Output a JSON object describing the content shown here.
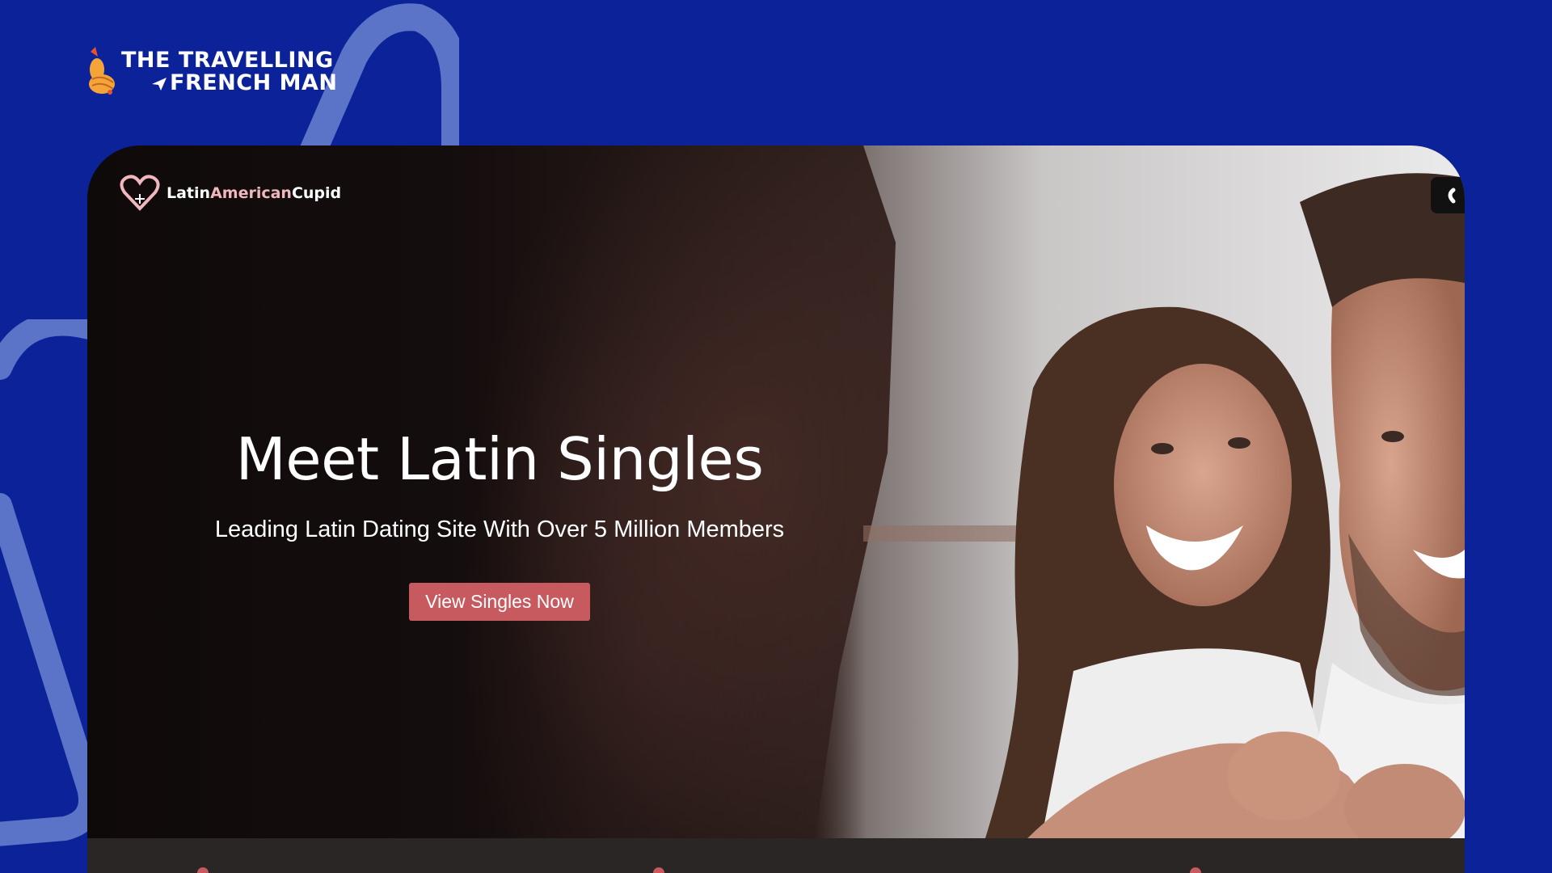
{
  "brand": {
    "line1": "THE TRAVELLING",
    "line2": "FRENCH MAN",
    "icon": "croissant-icon"
  },
  "site": {
    "logo_icon": "heart-icon",
    "logo_part1": "Latin",
    "logo_part2": "American",
    "logo_part3": "Cupid",
    "menu_icon": "menu-icon"
  },
  "hero": {
    "title": "Meet Latin Singles",
    "subtitle": "Leading Latin Dating Site With Over 5 Million Members",
    "cta_label": "View Singles Now"
  },
  "colors": {
    "page_background": "#0b2299",
    "decor_loop": "#5b74c7",
    "cta": "#c65a5e",
    "logo_accent": "#f0b7bd",
    "brand_orange": "#f5a43a"
  }
}
